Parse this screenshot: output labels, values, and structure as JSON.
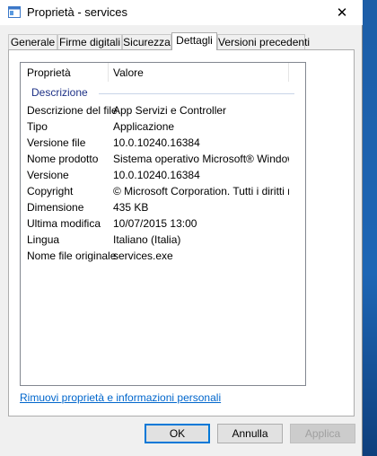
{
  "window": {
    "title": "Proprietà - services",
    "close_glyph": "✕"
  },
  "tabs": [
    {
      "label": "Generale"
    },
    {
      "label": "Firme digitali"
    },
    {
      "label": "Sicurezza"
    },
    {
      "label": "Dettagli",
      "active": true
    },
    {
      "label": "Versioni precedenti"
    }
  ],
  "list": {
    "column_headers": {
      "name": "Proprietà",
      "value": "Valore"
    },
    "group": "Descrizione",
    "rows": [
      {
        "name": "Descrizione del file",
        "value": "App Servizi e Controller"
      },
      {
        "name": "Tipo",
        "value": "Applicazione"
      },
      {
        "name": "Versione file",
        "value": "10.0.10240.16384"
      },
      {
        "name": "Nome prodotto",
        "value": "Sistema operativo Microsoft® Window..."
      },
      {
        "name": "Versione",
        "value": "10.0.10240.16384"
      },
      {
        "name": "Copyright",
        "value": "© Microsoft Corporation. Tutti i diritti ri..."
      },
      {
        "name": "Dimensione",
        "value": "435 KB"
      },
      {
        "name": "Ultima modifica",
        "value": "10/07/2015 13:00"
      },
      {
        "name": "Lingua",
        "value": "Italiano (Italia)"
      },
      {
        "name": "Nome file originale",
        "value": "services.exe"
      }
    ]
  },
  "remove_link": "Rimuovi proprietà e informazioni personali",
  "buttons": {
    "ok": "OK",
    "cancel": "Annulla",
    "apply": "Applica"
  },
  "colors": {
    "link": "#0066cc",
    "group_header": "#1e3287",
    "default_button_border": "#0078d7"
  }
}
